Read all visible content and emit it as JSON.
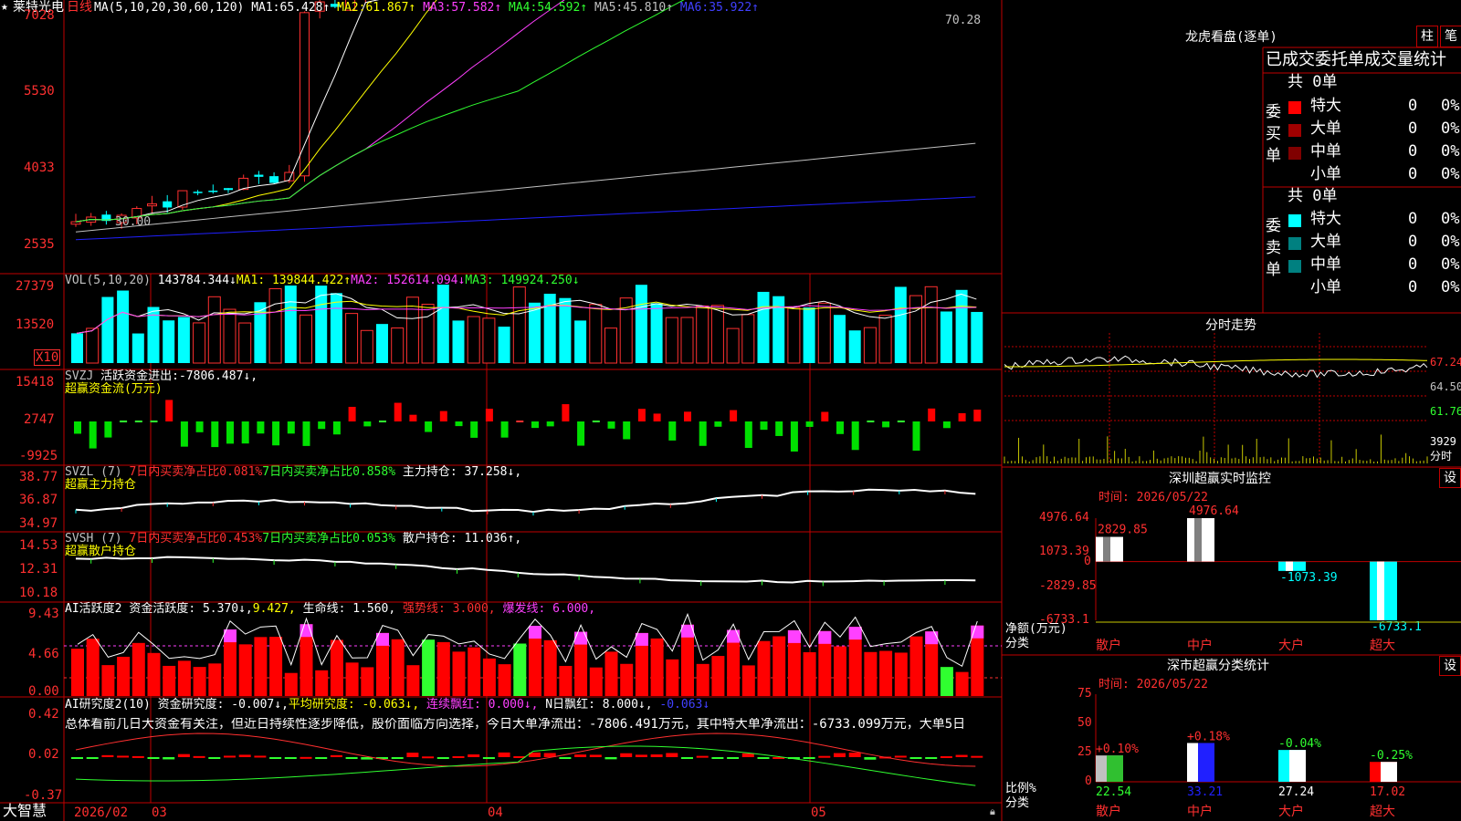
{
  "stock": {
    "name": "莱特光电",
    "period": "日线",
    "icon": "star-icon",
    "label": "★"
  },
  "bottom": {
    "brand": "大智慧",
    "date": "2026/02",
    "month03": "03",
    "month04": "04",
    "month05": "05"
  },
  "price_panel": {
    "ma_label": "MA(5,10,20,30,60,120)",
    "ma": [
      {
        "name": "MA1:",
        "value": "65.428↑",
        "color": "#ffffff"
      },
      {
        "name": "MA2:",
        "value": "61.867↑",
        "color": "#ffff00"
      },
      {
        "name": "MA3:",
        "value": "57.582↑",
        "color": "#ff40ff"
      },
      {
        "name": "MA4:",
        "value": "54.592↑",
        "color": "#30ff30"
      },
      {
        "name": "MA5:",
        "value": "45.810↑",
        "color": "#c0c0c0"
      },
      {
        "name": "MA6:",
        "value": "35.922↑",
        "color": "#2020ff"
      }
    ],
    "y_ticks": [
      "7028",
      "5530",
      "4033",
      "2535"
    ],
    "high_label": "70.28",
    "low_label": "30.00"
  },
  "vol_panel": {
    "title": "VOL(5,10,20)",
    "value": "143784.344↓",
    "ma1": "MA1: 139844.422↑",
    "ma2": "MA2: 152614.094↓",
    "ma3": "MA3: 149924.250↓",
    "y_ticks": [
      "27379",
      "13520"
    ],
    "unit": "X10"
  },
  "svzj_panel": {
    "title": "SVZJ",
    "label": "活跃资金进出:",
    "value": "-7806.487↓,",
    "subtitle": "超赢资金流(万元)",
    "y_ticks": [
      "15418",
      "2747",
      "-9925"
    ]
  },
  "svzl_panel": {
    "title": "SVZL (7)",
    "a_label": "7日内买卖净占比0.081%",
    "b_label": "7日内买卖净占比0.858%",
    "c_label": "主力持仓:",
    "c_value": "37.258↓,",
    "subtitle": "超赢主力持仓",
    "y_ticks": [
      "38.77",
      "36.87",
      "34.97"
    ]
  },
  "svsh_panel": {
    "title": "SVSH (7)",
    "a_label": "7日内买卖净占比0.453%",
    "b_label": "7日内买卖净占比0.053%",
    "c_label": "散户持仓:",
    "c_value": "11.036↑,",
    "subtitle": "超赢散户持仓",
    "y_ticks": [
      "14.53",
      "12.31",
      "10.18"
    ]
  },
  "ai1_panel": {
    "title": "AI活跃度2",
    "a": "资金活跃度: 5.370↓,",
    "b": "9.427,",
    "c": "生命线: 1.560,",
    "d": "强势线: 3.000,",
    "e": "爆发线: 6.000,",
    "y_ticks": [
      "9.43",
      "4.66",
      "0.00"
    ]
  },
  "ai2_panel": {
    "title": "AI研究度2(10)",
    "a": "资金研究度: -0.007↓,",
    "b": "平均研究度: -0.063↓,",
    "c": "连续飘红: 0.000↓,",
    "d": "N日飘红: 8.000↓,",
    "e": "-0.063↓",
    "summary": "总体看前几日大资金有关注，但近日持续性逐步降低，股价面临方向选择，今日大单净流出：-7806.491万元，其中特大单净流出：-6733.099万元，大单5日",
    "y_ticks": [
      "0.42",
      "0.02",
      "-0.37"
    ]
  },
  "dragon": {
    "title": "龙虎看盘(逐单)",
    "btn1": "柱",
    "btn2": "笔",
    "tabs": "已成交委托单成交量统计",
    "buy": {
      "label": "委买单",
      "total": "共 0单",
      "rows": [
        {
          "name": "特大",
          "n": "0",
          "p": "0%",
          "color": "#ff0000"
        },
        {
          "name": "大单",
          "n": "0",
          "p": "0%",
          "color": "#a00000"
        },
        {
          "name": "中单",
          "n": "0",
          "p": "0%",
          "color": "#800000"
        },
        {
          "name": "小单",
          "n": "0",
          "p": "0%",
          "color": ""
        }
      ]
    },
    "sell": {
      "label": "委卖单",
      "total": "共 0单",
      "rows": [
        {
          "name": "特大",
          "n": "0",
          "p": "0%",
          "color": "#00ffff"
        },
        {
          "name": "大单",
          "n": "0",
          "p": "0%",
          "color": "#008080"
        },
        {
          "name": "中单",
          "n": "0",
          "p": "0%",
          "color": "#008080"
        },
        {
          "name": "小单",
          "n": "0",
          "p": "0%",
          "color": ""
        }
      ]
    }
  },
  "intraday": {
    "title": "分时走势",
    "y_ticks": [
      "67.24",
      "64.50",
      "61.76"
    ],
    "vol_tick": "3929",
    "vol_label": "分时"
  },
  "monitor": {
    "title": "深圳超赢实时监控",
    "btn": "设",
    "time": "时间: 2026/05/22",
    "y_ticks": [
      "4976.64",
      "1073.39",
      "0",
      "-2829.85",
      "-6733.1"
    ],
    "net_label": "净额(万元)",
    "cat_label": "分类",
    "chart_data": {
      "type": "bar",
      "categories": [
        "散户",
        "中户",
        "大户",
        "超大"
      ],
      "values": [
        2829.85,
        4976.64,
        -1073.39,
        -6733.1
      ],
      "ylim": [
        -6733.1,
        4976.64
      ]
    }
  },
  "classify": {
    "title": "深市超赢分类统计",
    "btn": "设",
    "time": "时间: 2026/05/22",
    "y_ticks": [
      "75",
      "50",
      "25",
      "0"
    ],
    "ratio_label": "比例%",
    "cat_label": "分类",
    "chart_data": {
      "type": "bar",
      "categories": [
        "散户",
        "中户",
        "大户",
        "超大"
      ],
      "values": [
        22.54,
        33.21,
        27.24,
        17.02
      ],
      "changes": [
        "+0.10%",
        "+0.18%",
        "-0.04%",
        "-0.25%"
      ],
      "ylim": [
        0,
        75
      ]
    }
  }
}
